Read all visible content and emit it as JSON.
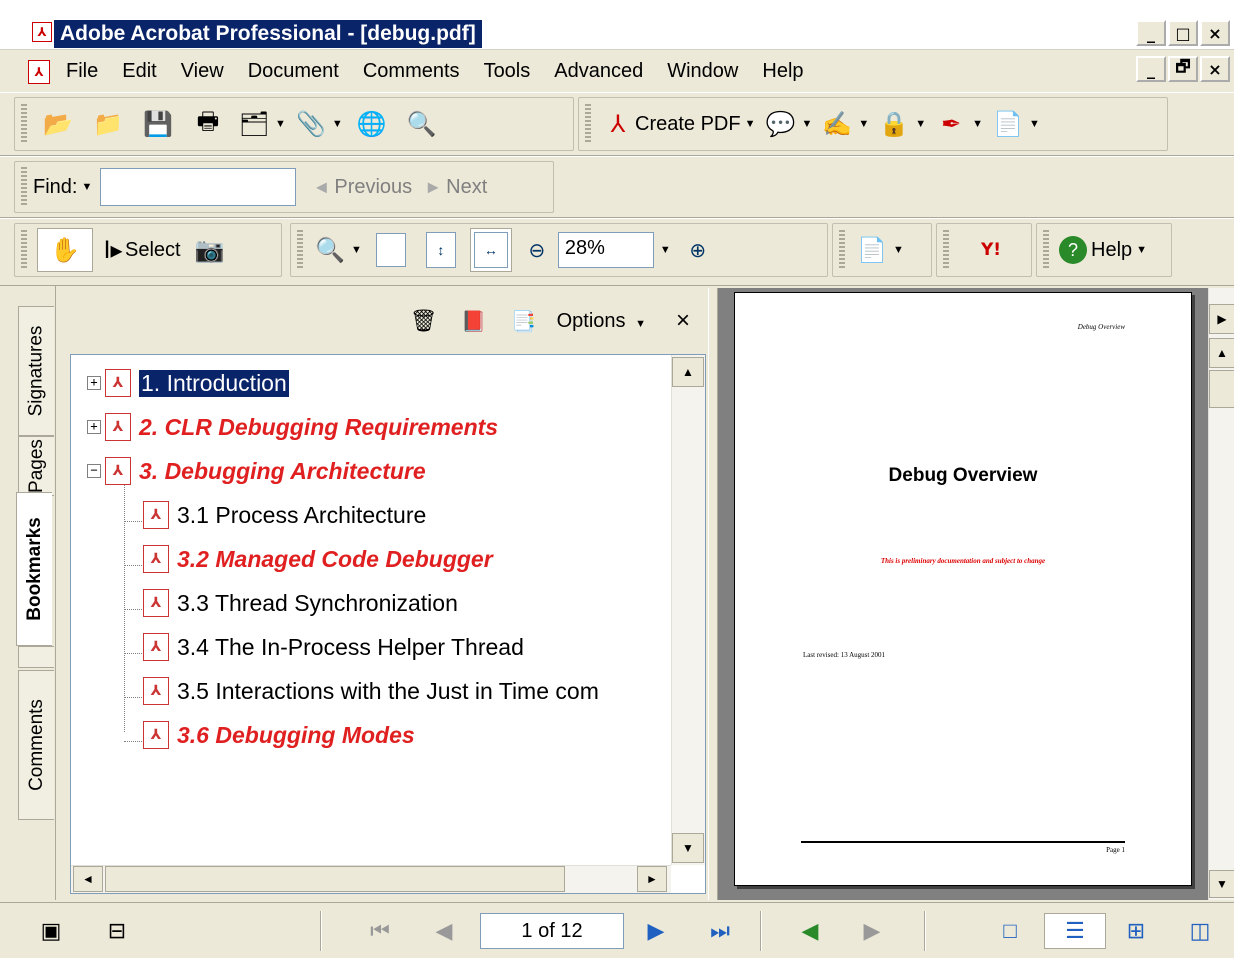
{
  "window": {
    "title": "Adobe Acrobat Professional - [debug.pdf]",
    "controls": [
      "_",
      "□",
      "×"
    ],
    "mdi_controls": [
      "_",
      "🗗",
      "×"
    ]
  },
  "menu": {
    "items": [
      "File",
      "Edit",
      "View",
      "Document",
      "Comments",
      "Tools",
      "Advanced",
      "Window",
      "Help"
    ]
  },
  "file_toolbar": {
    "icons": [
      "open-icon",
      "organizer-icon",
      "save-icon",
      "print-icon",
      "tasks-icon",
      "attach-icon",
      "email-icon",
      "search-icon"
    ]
  },
  "tasks_toolbar": {
    "create_pdf_label": "Create PDF",
    "icons": [
      "review-comment-icon",
      "sign-icon",
      "secure-lock-icon",
      "pen-icon",
      "forms-icon"
    ]
  },
  "find_toolbar": {
    "find_label": "Find:",
    "find_value": "",
    "previous_label": "Previous",
    "next_label": "Next"
  },
  "basic_toolbar": {
    "select_label": "Select",
    "zoom_value": "28%",
    "help_label": "Help"
  },
  "nav_tabs": {
    "signatures": "Signatures",
    "pages": "Pages",
    "bookmarks": "Bookmarks",
    "comments": "Comments"
  },
  "bookmarks_panel": {
    "options_label": "Options",
    "close_glyph": "×",
    "items": [
      {
        "label": "1. Introduction",
        "expander": "+",
        "style": "normal",
        "selected": true
      },
      {
        "label": "2. CLR Debugging Requirements",
        "expander": "+",
        "style": "red"
      },
      {
        "label": "3. Debugging Architecture",
        "expander": "−",
        "style": "red"
      },
      {
        "label": "3.1 Process Architecture",
        "style": "normal"
      },
      {
        "label": "3.2 Managed Code Debugger",
        "style": "red"
      },
      {
        "label": "3.3 Thread Synchronization",
        "style": "normal"
      },
      {
        "label": "3.4 The In-Process Helper Thread",
        "style": "normal"
      },
      {
        "label": "3.5 Interactions with the Just in Time com",
        "style": "normal"
      },
      {
        "label": "3.6 Debugging Modes",
        "style": "red"
      }
    ]
  },
  "document_page": {
    "header": "Debug Overview",
    "title": "Debug Overview",
    "note": "This is preliminary documentation and subject to change",
    "revised": "Last revised: 13 August 2001",
    "page_label": "Page 1"
  },
  "statusbar": {
    "page_indicator": "1 of 12"
  },
  "colors": {
    "chrome": "#ece9d8",
    "selection": "#0a246a",
    "bookmark_red": "#e02020",
    "document_bg": "#808080"
  }
}
